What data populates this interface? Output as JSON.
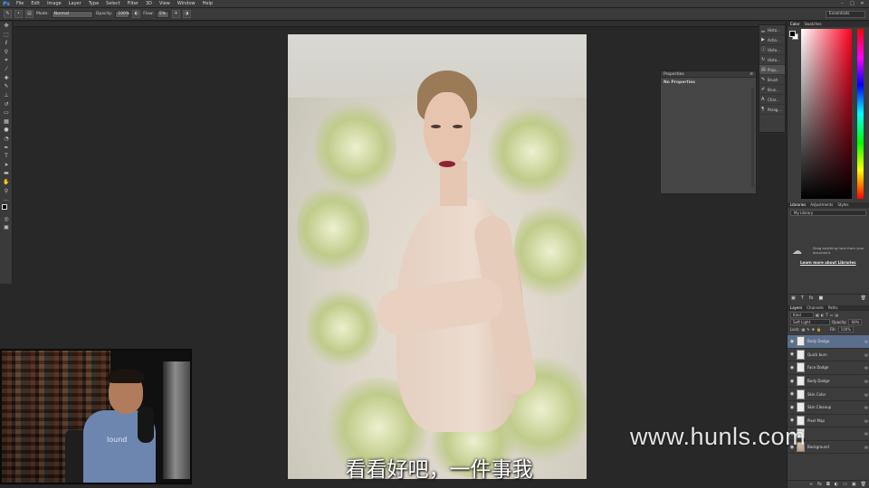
{
  "app": {
    "logo": "Ps"
  },
  "menu": [
    "File",
    "Edit",
    "Image",
    "Layer",
    "Type",
    "Select",
    "Filter",
    "3D",
    "View",
    "Window",
    "Help"
  ],
  "options_bar": {
    "mode_label": "Mode:",
    "mode_value": "Normal",
    "opacity_label": "Opacity:",
    "opacity_value": "100%",
    "flow_label": "Flow:",
    "flow_value": "5%",
    "workspace": "Essentials"
  },
  "tools": [
    "move",
    "marquee",
    "lasso",
    "quick-select",
    "crop",
    "eyedropper",
    "healing",
    "brush",
    "clone-stamp",
    "history-brush",
    "eraser",
    "gradient",
    "blur",
    "dodge",
    "pen",
    "type",
    "path-select",
    "shape",
    "hand",
    "zoom",
    "more"
  ],
  "properties_panel": {
    "title": "Properties",
    "body": "No Properties"
  },
  "mini_dock": [
    {
      "icon": "histogram-icon",
      "label": "Histo..."
    },
    {
      "icon": "actions-icon",
      "label": "Actio..."
    },
    {
      "icon": "info-icon",
      "label": "Histo..."
    },
    {
      "icon": "history-icon",
      "label": "Histo..."
    },
    {
      "icon": "properties-icon",
      "label": "Prop..."
    },
    {
      "icon": "brush-icon",
      "label": "Brush"
    },
    {
      "icon": "brush-presets-icon",
      "label": "Brus..."
    },
    {
      "icon": "character-icon",
      "label": "Char..."
    },
    {
      "icon": "paragraph-icon",
      "label": "Parag..."
    }
  ],
  "color_panel": {
    "tabs": [
      "Color",
      "Swatches"
    ],
    "active_tab": 0
  },
  "libraries_panel": {
    "tabs": [
      "Libraries",
      "Adjustments",
      "Styles"
    ],
    "library": "My Library",
    "hint": "Drag anything here from your document",
    "link": "Learn more about Libraries"
  },
  "layers_panel": {
    "tabs": [
      "Layers",
      "Channels",
      "Paths"
    ],
    "filter": "Kind",
    "blend_mode": "Soft Light",
    "opacity_label": "Opacity:",
    "opacity_value": "60%",
    "lock_label": "Lock:",
    "fill_label": "Fill:",
    "fill_value": "100%",
    "layers": [
      {
        "name": "Body Dodge",
        "selected": true
      },
      {
        "name": "Quick burn",
        "selected": false
      },
      {
        "name": "Face Dodge",
        "selected": false
      },
      {
        "name": "Body Dodge",
        "selected": false
      },
      {
        "name": "Skin Color",
        "selected": false
      },
      {
        "name": "Skin Cleanup",
        "selected": false
      },
      {
        "name": "Pixel Map",
        "selected": false
      },
      {
        "name": "",
        "selected": false
      },
      {
        "name": "Background",
        "selected": false
      }
    ]
  },
  "webcam": {
    "shirt_text": "lound"
  },
  "subtitle": "看看好吧，一件事我",
  "watermark": "www.hunls.com"
}
